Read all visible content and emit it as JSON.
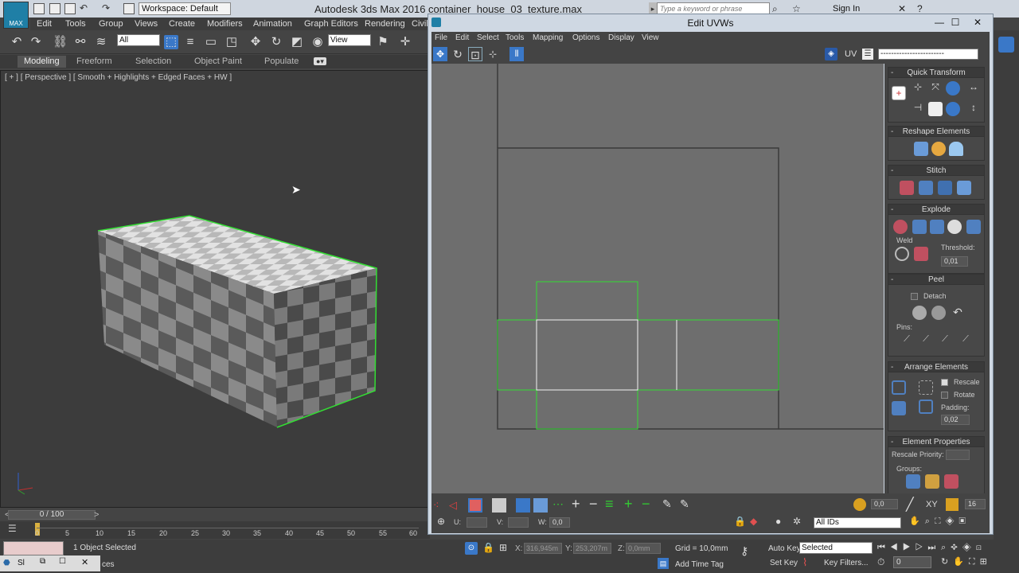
{
  "app": {
    "title": "Autodesk 3ds Max 2016",
    "file": "container_house_03_texture.max",
    "logo_text": "MAX",
    "workspace": "Workspace: Default",
    "search_placeholder": "Type a keyword or phrase",
    "sign_in": "Sign In"
  },
  "menu": [
    "Edit",
    "Tools",
    "Group",
    "Views",
    "Create",
    "Modifiers",
    "Animation",
    "Graph Editors",
    "Rendering",
    "Civil"
  ],
  "toolbar": {
    "filter_select": "All",
    "view_select": "View"
  },
  "ribbon": [
    "Modeling",
    "Freeform",
    "Selection",
    "Object Paint",
    "Populate"
  ],
  "viewport": {
    "label": "[ + ] [ Perspective ] [ Smooth + Highlights + Edged Faces + HW ]"
  },
  "timeline": {
    "position": "0 / 100",
    "ticks": [
      "0",
      "5",
      "10",
      "15",
      "20",
      "25",
      "30",
      "35",
      "40",
      "45",
      "50",
      "55",
      "60"
    ]
  },
  "status": {
    "selected_text": "1 Object Selected",
    "x_label": "X:",
    "x_value": "316,945m",
    "y_label": "Y:",
    "y_value": "253,207m",
    "z_label": "Z:",
    "z_value": "0,0mm",
    "grid": "Grid = 10,0mm",
    "add_time_tag": "Add Time Tag",
    "auto_key": "Auto Key",
    "set_key": "Set Key",
    "key_filters": "Key Filters...",
    "selected_option": "Selected",
    "frame": "0",
    "min_win_label": "Sl",
    "min_win_trail": "ces"
  },
  "uvw": {
    "title": "Edit UVWs",
    "menu": [
      "File",
      "Edit",
      "Select",
      "Tools",
      "Mapping",
      "Options",
      "Display",
      "View"
    ],
    "uv_label": "UV",
    "uv_dropdown": "------------------------",
    "bottom": {
      "u_label": "U:",
      "v_label": "V:",
      "w_label": "W:",
      "w_value": "0,0",
      "spin_value": "0,0",
      "xy_label": "XY",
      "grid_value": "16",
      "ids_select": "All IDs"
    },
    "panel": {
      "quick_transform": "Quick Transform",
      "reshape": "Reshape Elements",
      "stitch": "Stitch",
      "explode": "Explode",
      "weld": "Weld",
      "threshold_label": "Threshold:",
      "threshold_value": "0,01",
      "peel": "Peel",
      "detach": "Detach",
      "pins": "Pins:",
      "arrange": "Arrange Elements",
      "rescale": "Rescale",
      "rotate": "Rotate",
      "padding_label": "Padding:",
      "padding_value": "0,02",
      "element_props": "Element Properties",
      "rescale_priority": "Rescale Priority:",
      "groups": "Groups:"
    }
  },
  "colors": {
    "selection_green": "#33dd33",
    "accent_blue": "#3a78c8",
    "titlebar": "#cfd6df"
  }
}
